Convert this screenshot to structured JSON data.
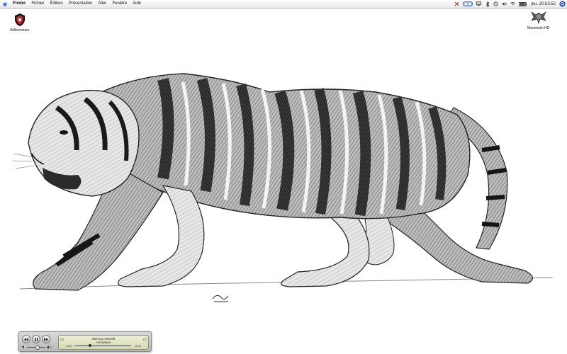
{
  "menubar": {
    "app_name": "Finder",
    "items": [
      "Fichier",
      "Édition",
      "Présentation",
      "Aller",
      "Fenêtre",
      "Aide"
    ],
    "clock": "jeu. 20:53:52"
  },
  "desktop": {
    "icons": [
      {
        "label": "Willkommen",
        "icon": "badge-icon"
      },
      {
        "label": "Macintosh HD",
        "icon": "hard-drive-icon"
      }
    ],
    "wallpaper": "tiger-pencil-sketch"
  },
  "player": {
    "song_title": "Mercury Retrofit",
    "artist": "Hecyaeos",
    "elapsed": "1:00",
    "remaining": "-2:31",
    "progress": 0.28,
    "volume": 0.55
  },
  "colors": {
    "menubar": "#ececec",
    "lcd": "#e2e5c4",
    "accent": "#3b73c8"
  }
}
